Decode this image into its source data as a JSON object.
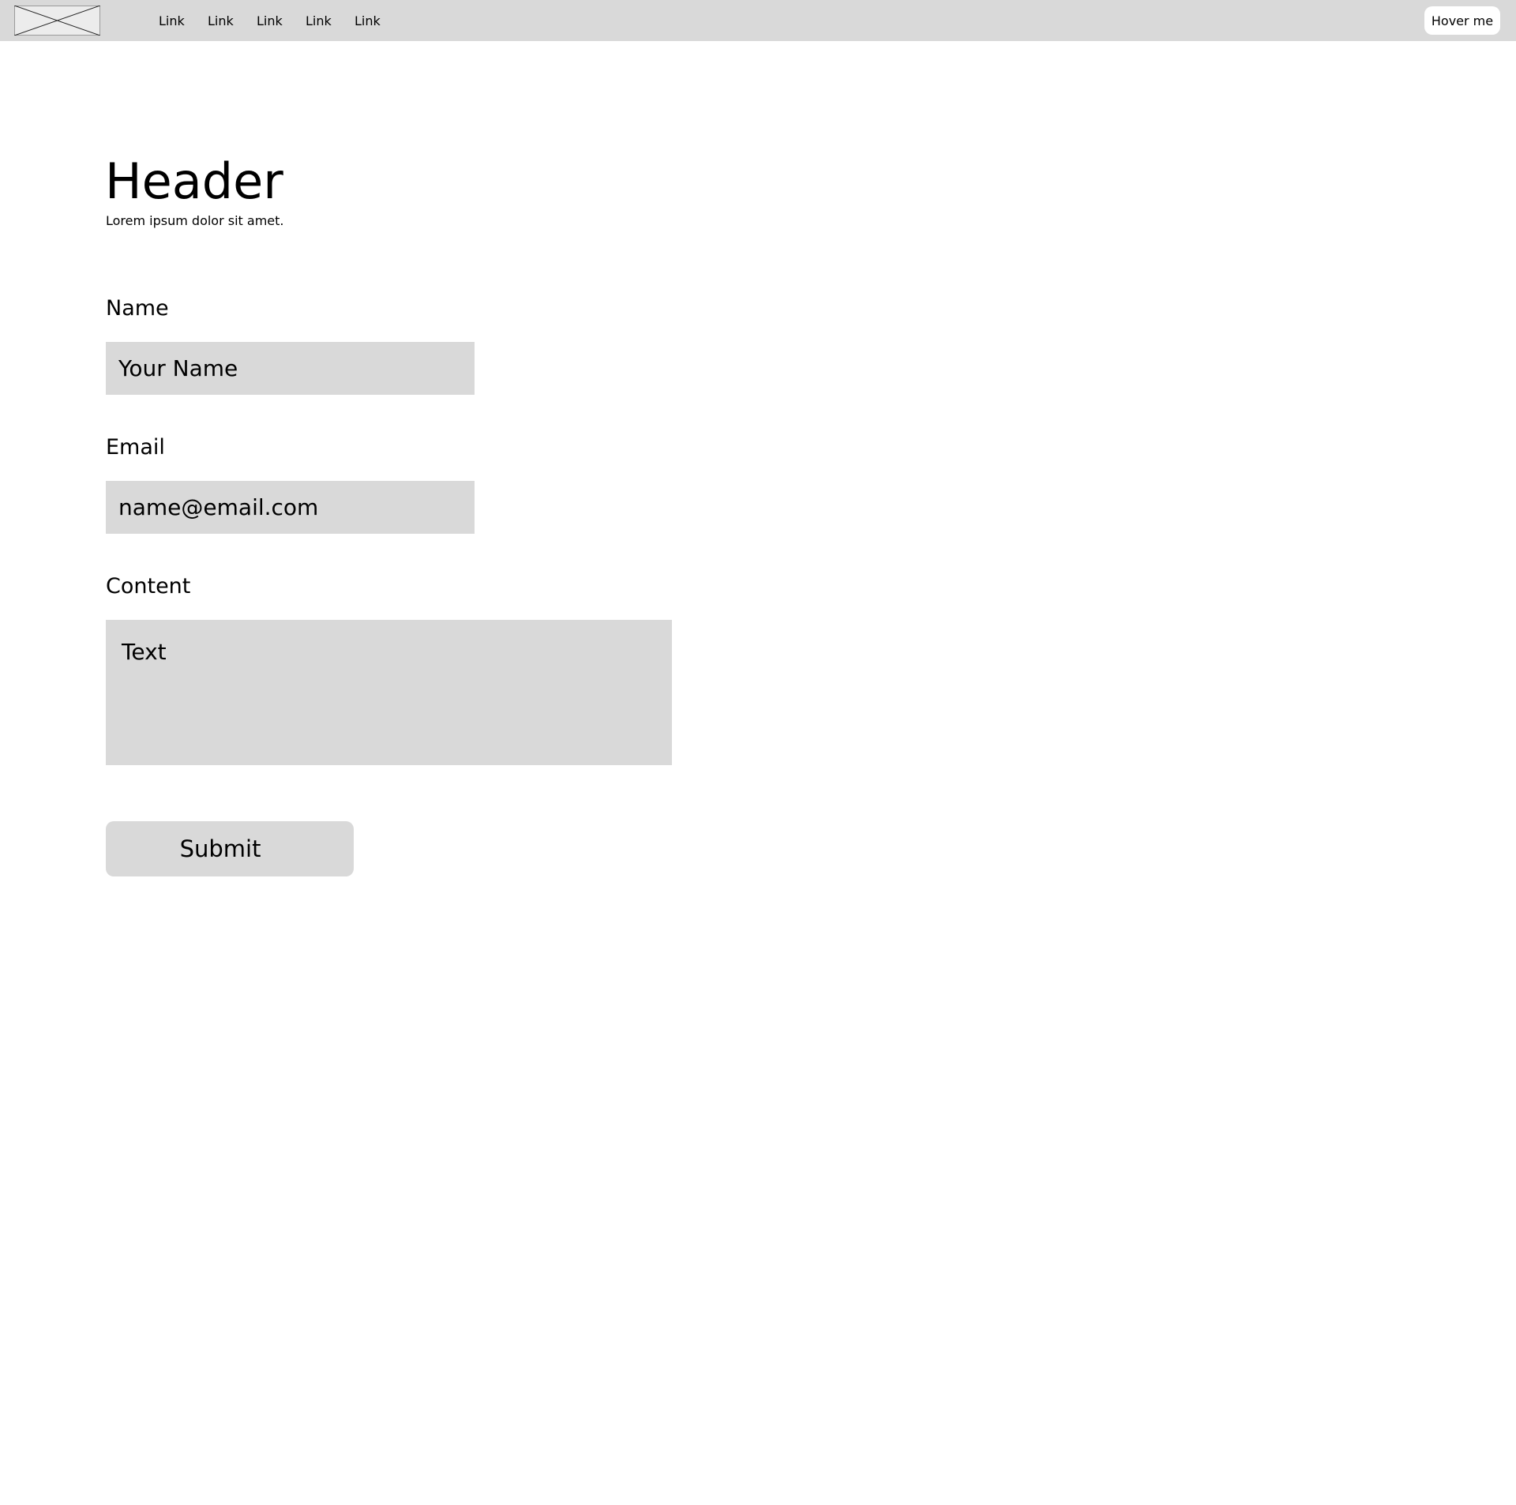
{
  "topbar": {
    "logo_icon": "image-placeholder-icon",
    "links": [
      "Link",
      "Link",
      "Link",
      "Link",
      "Link"
    ],
    "hover_button_label": "Hover me"
  },
  "main": {
    "title": "Header",
    "subtitle": "Lorem ipsum dolor sit amet."
  },
  "form": {
    "name": {
      "label": "Name",
      "value": "Your Name"
    },
    "email": {
      "label": "Email",
      "value": "name@email.com"
    },
    "content": {
      "label": "Content",
      "value": "Text"
    },
    "submit_label": "Submit"
  },
  "colors": {
    "bar_background": "#d9d9d9",
    "field_background": "#d9d9d9",
    "page_background": "#ffffff",
    "text": "#000000"
  }
}
